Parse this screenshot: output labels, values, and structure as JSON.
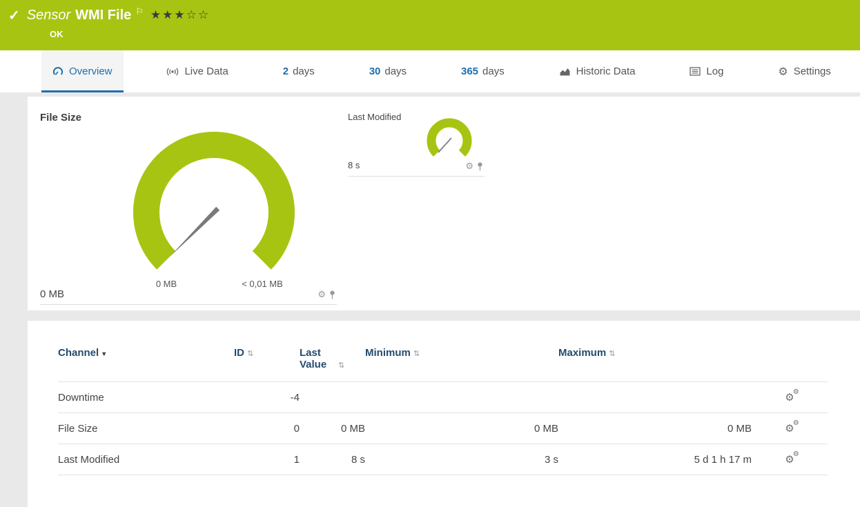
{
  "header": {
    "check_icon": "✓",
    "sensor_label": "Sensor",
    "sensor_name": "WMI File",
    "flag_icon": "⚐",
    "stars": "★★★☆☆",
    "status": "OK"
  },
  "tabs": {
    "overview": "Overview",
    "live_data": "Live Data",
    "days2_num": "2",
    "days2_label": "days",
    "days30_num": "30",
    "days30_label": "days",
    "days365_num": "365",
    "days365_label": "days",
    "historic": "Historic Data",
    "log": "Log",
    "settings": "Settings",
    "settings_icon": "⚙"
  },
  "gauges": {
    "file_size": {
      "title": "File Size",
      "value": "0 MB",
      "min": "0 MB",
      "max": "< 0,01 MB"
    },
    "last_modified": {
      "title": "Last Modified",
      "value": "8 s"
    }
  },
  "channel_table": {
    "headers": {
      "channel": "Channel",
      "id": "ID",
      "last_value": "Last Value",
      "minimum": "Minimum",
      "maximum": "Maximum"
    },
    "rows": [
      {
        "channel": "Downtime",
        "id": "-4",
        "last_value": "",
        "minimum": "",
        "maximum": ""
      },
      {
        "channel": "File Size",
        "id": "0",
        "last_value": "0 MB",
        "minimum": "0 MB",
        "maximum": "0 MB"
      },
      {
        "channel": "Last Modified",
        "id": "1",
        "last_value": "8 s",
        "minimum": "3 s",
        "maximum": "5 d 1 h 17 m"
      }
    ]
  },
  "icons": {
    "gear": "⚙",
    "sort": "⇅",
    "sorted_desc": "▾"
  },
  "colors": {
    "brand_green": "#a8c412",
    "accent_blue": "#1b6fb1"
  }
}
